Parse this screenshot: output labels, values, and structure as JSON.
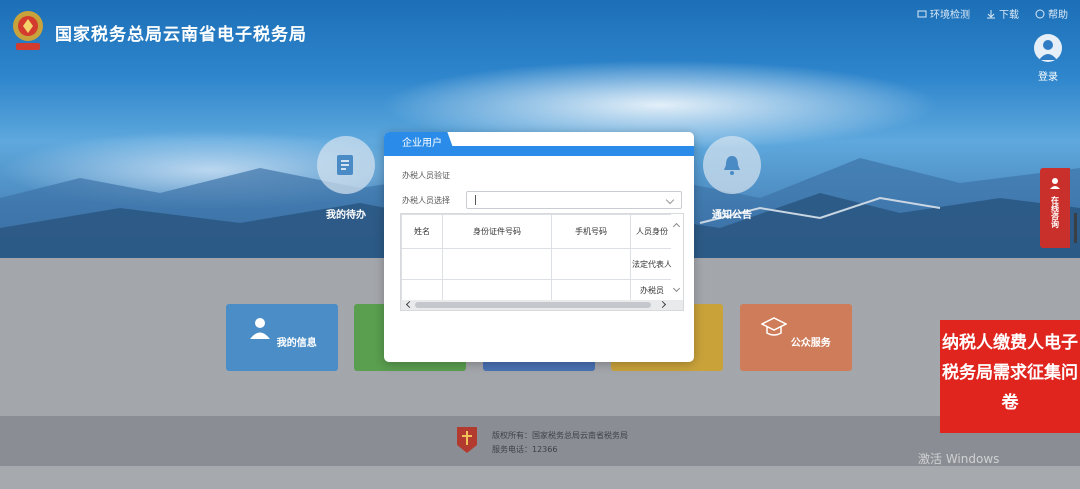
{
  "site": {
    "title": "国家税务总局云南省电子税务局",
    "logo_icon": "tax-emblem-icon"
  },
  "top_links": [
    {
      "label": "环境检测",
      "icon": "environment-check-icon"
    },
    {
      "label": "下载",
      "icon": "download-icon"
    },
    {
      "label": "帮助",
      "icon": "help-icon"
    }
  ],
  "user": {
    "label": "登录",
    "icon": "user-avatar-icon"
  },
  "banner_items": [
    {
      "label": "我的待办",
      "icon": "todo-icon"
    },
    {
      "label": "通知公告",
      "icon": "bell-icon"
    }
  ],
  "tiles": [
    {
      "label": "我的信息",
      "color": "#4b8ec7",
      "icon": "person-icon"
    },
    {
      "label": "",
      "color": "#5a9e4f",
      "icon": ""
    },
    {
      "label": "",
      "color": "#4a72b3",
      "icon": ""
    },
    {
      "label": "",
      "color": "#c9a23a",
      "icon": ""
    },
    {
      "label": "公众服务",
      "color": "#cf7c5a",
      "icon": "mortarboard-icon"
    }
  ],
  "footer": {
    "copyright": "版权所有：国家税务总局云南省税务局",
    "service_phone": "服务电话：12366"
  },
  "side": {
    "online_consult": "在线咨询",
    "survey": "纳税人缴费人电子税务局需求征集问卷"
  },
  "watermark": "激活 Windows",
  "modal": {
    "tab_label": "企业用户",
    "section_title": "办税人员验证",
    "select_label": "办税人员选择",
    "select_value": "",
    "columns": [
      "姓名",
      "身份证件号码",
      "手机号码",
      "人员身份"
    ],
    "rows": [
      {
        "name": "",
        "id_number": "",
        "phone": "",
        "role": "法定代表人"
      },
      {
        "name": "",
        "id_number": "",
        "phone": "",
        "role": "办税员"
      }
    ]
  },
  "colors": {
    "accent": "#2a8ce8",
    "survey_red": "#e0251f"
  }
}
